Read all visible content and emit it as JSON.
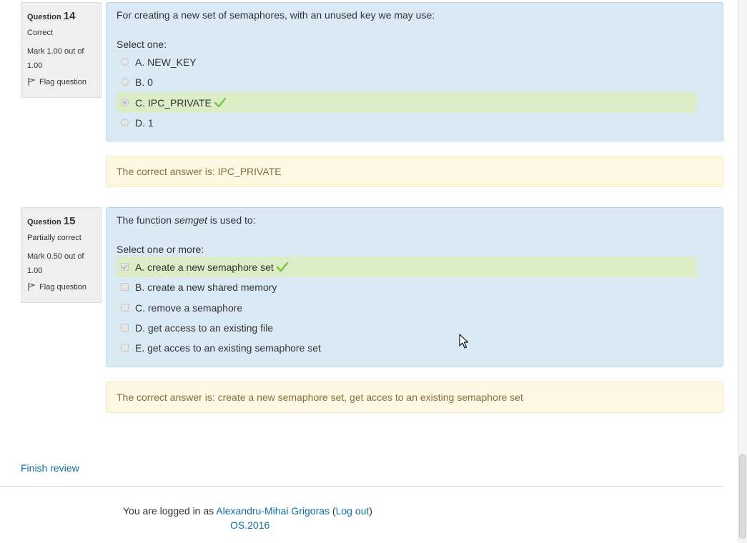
{
  "questions": [
    {
      "label": "Question",
      "number": "14",
      "state": "Correct",
      "grade": "Mark 1.00 out of 1.00",
      "flag": "Flag question",
      "text": "For creating a new set of semaphores, with an unused key we may use:",
      "prompt": "Select one:",
      "answer_type": "radio",
      "options": [
        {
          "label": "A. NEW_KEY",
          "selected": false,
          "correct": false
        },
        {
          "label": "B. 0",
          "selected": false,
          "correct": false
        },
        {
          "label": "C. IPC_PRIVATE",
          "selected": true,
          "correct": true
        },
        {
          "label": "D. 1",
          "selected": false,
          "correct": false
        }
      ],
      "feedback": "The correct answer is: IPC_PRIVATE"
    },
    {
      "label": "Question",
      "number": "15",
      "state": "Partially correct",
      "grade": "Mark 0.50 out of 1.00",
      "flag": "Flag question",
      "text_before": "The function ",
      "text_em": "semget",
      "text_after": " is used to:",
      "prompt": "Select one or more:",
      "answer_type": "checkbox",
      "options": [
        {
          "label": "A. create a new semaphore set",
          "selected": true,
          "correct": true
        },
        {
          "label": "B. create a new shared memory",
          "selected": false,
          "correct": false
        },
        {
          "label": "C. remove a semaphore",
          "selected": false,
          "correct": false
        },
        {
          "label": "D. get access to an existing file",
          "selected": false,
          "correct": false
        },
        {
          "label": "E. get acces to an existing semaphore set",
          "selected": false,
          "correct": false
        }
      ],
      "feedback": "The correct answer is: create a new semaphore set, get acces to an existing semaphore set"
    }
  ],
  "finish_review": "Finish review",
  "footer": {
    "logged_in_prefix": "You are logged in as",
    "user_name": "Alexandru-Mihai Grigoras",
    "logout": "Log out",
    "course": "OS.2016"
  },
  "colors": {
    "formulation_bg": "#d9eaf4",
    "correct_bg": "#dcecc6",
    "feedback_bg": "#fcf8e3",
    "feedback_text": "#8a6d3b",
    "link": "#0e6e9e",
    "tick": "#7cc243"
  },
  "icons": [
    "flag-icon",
    "correct-tick-icon",
    "mouse-cursor-icon"
  ]
}
